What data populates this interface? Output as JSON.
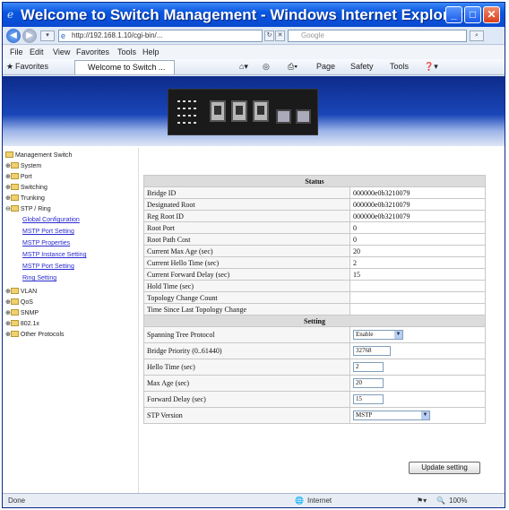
{
  "window": {
    "title": "Welcome to Switch Management - Windows Internet Explorer"
  },
  "addressbar": {
    "url": "http://192.168.1.10/cgi-bin/...",
    "search_placeholder": "Google"
  },
  "menubar": [
    "File",
    "Edit",
    "View",
    "Favorites",
    "Tools",
    "Help"
  ],
  "favbar": {
    "favorites": "Favorites",
    "tab": "Welcome to Switch ...",
    "page": "Page",
    "safety": "Safety",
    "tools": "Tools"
  },
  "sidebar": {
    "root": "Management Switch",
    "items": [
      "System",
      "Port",
      "Switching",
      "Trunking",
      "STP / Ring"
    ],
    "stp_sub": [
      "Global Configuration",
      "MSTP Port Setting",
      "MSTP Properties",
      "MSTP Instance Setting",
      "MSTP Port Setting",
      "Ring Setting"
    ],
    "items2": [
      "VLAN",
      "QoS",
      "SNMP",
      "802.1x",
      "Other Protocols"
    ]
  },
  "status": {
    "header": "Status",
    "rows": [
      {
        "label": "Bridge ID",
        "value": "000000e0b3210079"
      },
      {
        "label": "Designated Root",
        "value": "000000e0b3210079"
      },
      {
        "label": "Reg Root ID",
        "value": "000000e0b3210079"
      },
      {
        "label": "Root Port",
        "value": "0"
      },
      {
        "label": "Root Path Cost",
        "value": "0"
      },
      {
        "label": "Current Max Age (sec)",
        "value": "20"
      },
      {
        "label": "Current Hello Time (sec)",
        "value": "2"
      },
      {
        "label": "Current Forward Delay (sec)",
        "value": "15"
      },
      {
        "label": "Hold Time (sec)",
        "value": ""
      },
      {
        "label": "Topology Change Count",
        "value": ""
      },
      {
        "label": "Time Since Last Topology Change",
        "value": ""
      }
    ]
  },
  "setting": {
    "header": "Setting",
    "spanning_tree_protocol": {
      "label": "Spanning Tree Protocol",
      "value": "Enable"
    },
    "bridge_priority": {
      "label": "Bridge Priority (0..61440)",
      "value": "32768"
    },
    "hello_time": {
      "label": "Hello Time (sec)",
      "value": "2"
    },
    "max_age": {
      "label": "Max Age (sec)",
      "value": "20"
    },
    "forward_delay": {
      "label": "Forward Delay (sec)",
      "value": "15"
    },
    "stp_version": {
      "label": "STP Version",
      "value": "MSTP"
    },
    "update_button": "Update setting"
  },
  "statusbar": {
    "left": "Done",
    "zone": "Internet",
    "zoom": "100%"
  }
}
